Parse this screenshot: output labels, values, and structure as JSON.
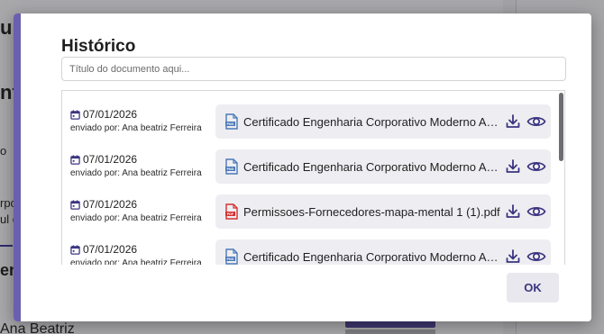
{
  "background": {
    "text_1": "ur",
    "text_2": "nto",
    "text_3": "o",
    "text_4": "rpo",
    "text_5": "ul e",
    "text_6": "ent",
    "text_7": "Ana Beatriz"
  },
  "modal": {
    "title": "Histórico",
    "search": {
      "placeholder": "Título do documento aqui...",
      "value": ""
    },
    "entries": [
      {
        "date": "07/01/2026",
        "sender": "enviado por: Ana beatriz Ferreira",
        "file_name": "Certificado Engenharia Corporativo Moderno Azul.png",
        "file_type": "PNG",
        "file_icon": "png-file-icon"
      },
      {
        "date": "07/01/2026",
        "sender": "enviado por: Ana beatriz Ferreira",
        "file_name": "Certificado Engenharia Corporativo Moderno Azul.png",
        "file_type": "PNG",
        "file_icon": "png-file-icon"
      },
      {
        "date": "07/01/2026",
        "sender": "enviado por: Ana beatriz Ferreira",
        "file_name": "Permissoes-Fornecedores-mapa-mental 1 (1).pdf",
        "file_type": "PDF",
        "file_icon": "pdf-file-icon"
      },
      {
        "date": "07/01/2026",
        "sender": "enviado por: Ana beatriz Ferreira",
        "file_name": "Certificado Engenharia Corporativo Moderno Azul.png",
        "file_type": "PNG",
        "file_icon": "png-file-icon"
      }
    ],
    "ok_label": "OK"
  },
  "colors": {
    "accent": "#6a5fb0",
    "icon": "#3b3480",
    "png_icon": "#4a78b8",
    "pdf_icon": "#d32f2f"
  }
}
